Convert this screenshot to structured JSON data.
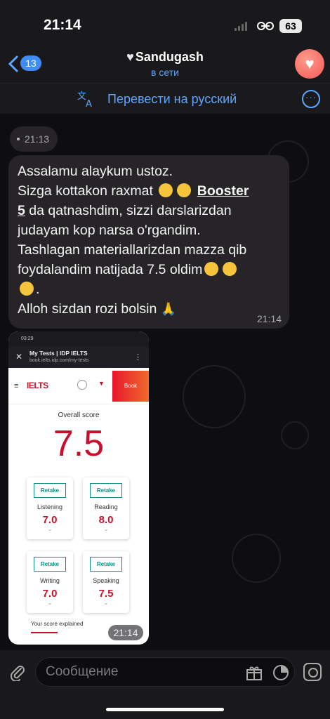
{
  "status_bar": {
    "time": "21:14",
    "battery": "63"
  },
  "header": {
    "back_count": "13",
    "name": "Sandugash",
    "status": "в сети"
  },
  "translate_bar": {
    "label": "Перевести на русский"
  },
  "messages": {
    "first_time": "21:13",
    "text_lines": [
      "Assalamu alaykum ustoz.",
      "Sizga kottakon raxmat ",
      "5",
      " da qatnashdim, sizzi darslarizdan",
      "judayam kop narsa o'rgandim.",
      "Tashlagan materiallarizdan mazza qib",
      "foydalandim natijada 7.5 oldim",
      ".",
      "Alloh sizdan rozi bolsin "
    ],
    "link_text": "Booster",
    "text_time": "21:14",
    "photo_time": "21:14"
  },
  "photo": {
    "status_time": "03:29",
    "page_title": "My Tests | IDP IELTS",
    "page_url": "book.ielts.idp.com/my-tests",
    "logo": "IELTS",
    "book": "Book",
    "overall_label": "Overall score",
    "overall_score": "7.5",
    "retake": "Retake",
    "scores": [
      {
        "name": "Listening",
        "value": "7.0"
      },
      {
        "name": "Reading",
        "value": "8.0"
      },
      {
        "name": "Writing",
        "value": "7.0"
      },
      {
        "name": "Speaking",
        "value": "7.5"
      }
    ],
    "explained": "Your score explained"
  },
  "input": {
    "placeholder": "Сообщение"
  },
  "colors": {
    "accent": "#5ea6ff",
    "bubble": "#262427",
    "ielts_red": "#c8102e",
    "retake_teal": "#0f8f80"
  },
  "icons": [
    "back-chevron-icon",
    "heart-icon",
    "translate-icon",
    "more-icon",
    "paperclip-icon",
    "gift-icon",
    "sticker-icon",
    "camera-icon",
    "emoji-icon",
    "pray-icon"
  ]
}
